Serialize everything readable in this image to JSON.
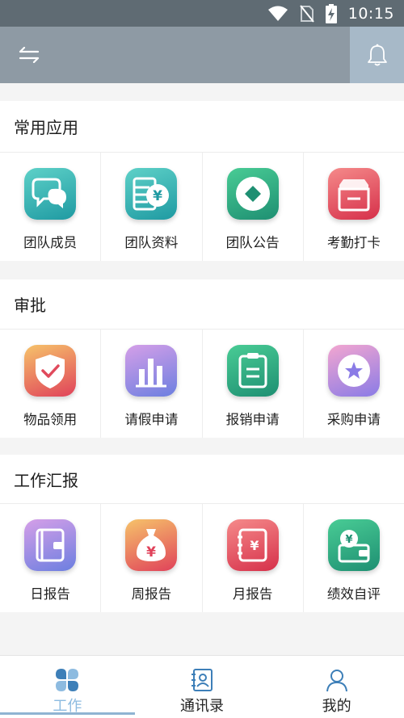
{
  "status_bar": {
    "time": "10:15"
  },
  "sections": [
    {
      "title": "常用应用",
      "items": [
        {
          "label": "团队成员",
          "icon": "team-members-icon"
        },
        {
          "label": "团队资料",
          "icon": "team-files-icon"
        },
        {
          "label": "团队公告",
          "icon": "team-announcement-icon"
        },
        {
          "label": "考勤打卡",
          "icon": "attendance-icon"
        }
      ]
    },
    {
      "title": "审批",
      "items": [
        {
          "label": "物品领用",
          "icon": "item-requisition-icon"
        },
        {
          "label": "请假申请",
          "icon": "leave-request-icon"
        },
        {
          "label": "报销申请",
          "icon": "reimbursement-icon"
        },
        {
          "label": "采购申请",
          "icon": "purchase-request-icon"
        }
      ]
    },
    {
      "title": "工作汇报",
      "items": [
        {
          "label": "日报告",
          "icon": "daily-report-icon"
        },
        {
          "label": "周报告",
          "icon": "weekly-report-icon"
        },
        {
          "label": "月报告",
          "icon": "monthly-report-icon"
        },
        {
          "label": "绩效自评",
          "icon": "performance-review-icon"
        }
      ]
    }
  ],
  "bottom_nav": [
    {
      "label": "工作",
      "active": true
    },
    {
      "label": "通讯录",
      "active": false
    },
    {
      "label": "我的",
      "active": false
    }
  ],
  "colors": {
    "top_bar": "#8e9aa4",
    "active_tab": "#8dbbe0"
  }
}
